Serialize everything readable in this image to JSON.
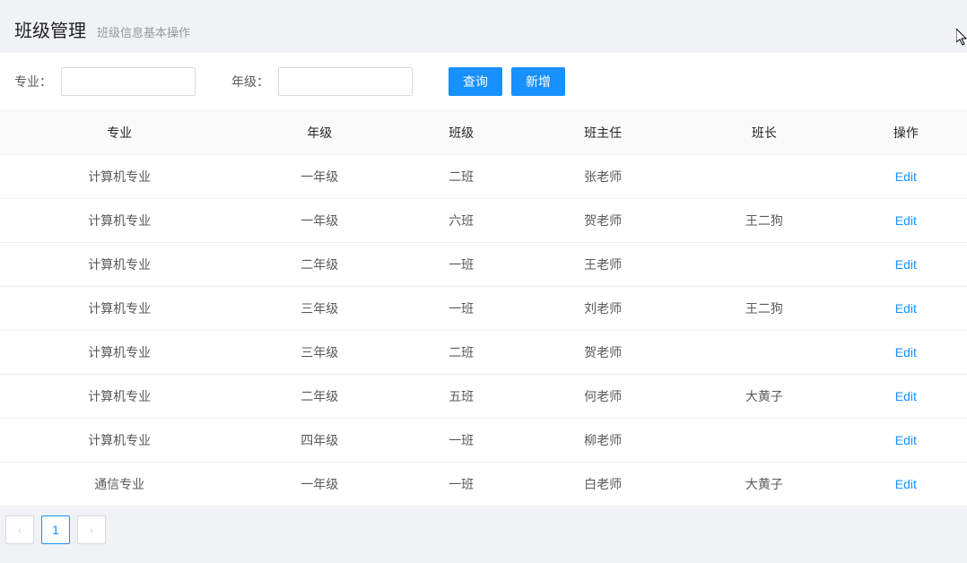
{
  "header": {
    "title": "班级管理",
    "subtitle": "班级信息基本操作"
  },
  "filters": {
    "major_label": "专业：",
    "major_value": "",
    "grade_label": "年级：",
    "grade_value": "",
    "search_label": "查询",
    "add_label": "新增"
  },
  "table": {
    "columns": [
      "专业",
      "年级",
      "班级",
      "班主任",
      "班长",
      "操作"
    ],
    "edit_label": "Edit",
    "rows": [
      {
        "major": "计算机专业",
        "grade": "一年级",
        "class": "二班",
        "head_teacher": "张老师",
        "monitor": ""
      },
      {
        "major": "计算机专业",
        "grade": "一年级",
        "class": "六班",
        "head_teacher": "贺老师",
        "monitor": "王二狗"
      },
      {
        "major": "计算机专业",
        "grade": "二年级",
        "class": "一班",
        "head_teacher": "王老师",
        "monitor": ""
      },
      {
        "major": "计算机专业",
        "grade": "三年级",
        "class": "一班",
        "head_teacher": "刘老师",
        "monitor": "王二狗"
      },
      {
        "major": "计算机专业",
        "grade": "三年级",
        "class": "二班",
        "head_teacher": "贺老师",
        "monitor": ""
      },
      {
        "major": "计算机专业",
        "grade": "二年级",
        "class": "五班",
        "head_teacher": "何老师",
        "monitor": "大黄子"
      },
      {
        "major": "计算机专业",
        "grade": "四年级",
        "class": "一班",
        "head_teacher": "柳老师",
        "monitor": ""
      },
      {
        "major": "通信专业",
        "grade": "一年级",
        "class": "一班",
        "head_teacher": "白老师",
        "monitor": "大黄子"
      }
    ]
  },
  "pagination": {
    "current": "1"
  }
}
